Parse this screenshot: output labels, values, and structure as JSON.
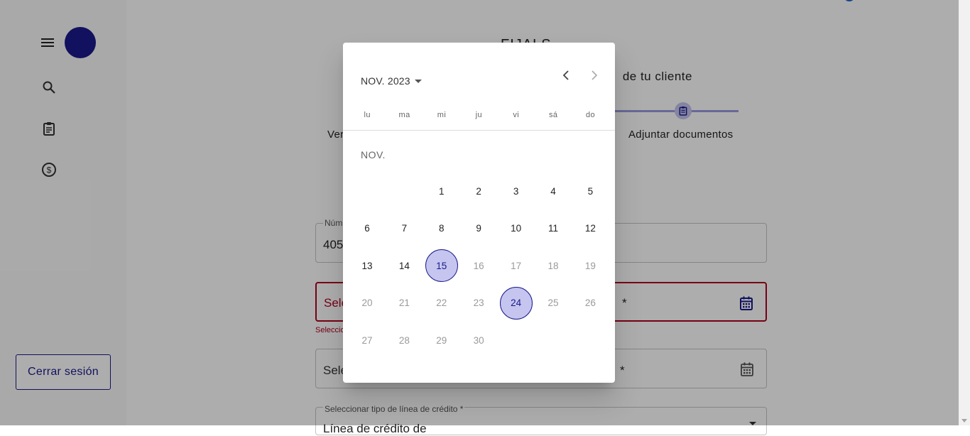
{
  "sidebar": {
    "logout_label": "Cerrar sesión",
    "icons": [
      "menu-icon",
      "search-icon",
      "clipboard-icon",
      "dollar-icon"
    ]
  },
  "header": {
    "title": "FIJALS",
    "step_title": "de tu cliente",
    "step_left_label": "Ver",
    "step_right_label": "Adjuntar documentos"
  },
  "form": {
    "field1_label": "Núm",
    "field1_value": "405",
    "field2_placeholder": "Sele",
    "field2_suffix": "*",
    "field2_helper": "Seleccio",
    "field3_placeholder": "Sele",
    "field3_suffix": "*",
    "field4_label": "Seleccionar tipo de línea de crédito *",
    "field4_value": "Línea de crédito de"
  },
  "datepicker": {
    "period_label": "NOV. 2023",
    "month_label": "NOV.",
    "weekdays": [
      "lu",
      "ma",
      "mi",
      "ju",
      "vi",
      "sá",
      "do"
    ],
    "days": [
      {
        "d": "1",
        "state": "enabled"
      },
      {
        "d": "2",
        "state": "enabled"
      },
      {
        "d": "3",
        "state": "enabled"
      },
      {
        "d": "4",
        "state": "enabled"
      },
      {
        "d": "5",
        "state": "enabled"
      },
      {
        "d": "6",
        "state": "enabled"
      },
      {
        "d": "7",
        "state": "enabled"
      },
      {
        "d": "8",
        "state": "enabled"
      },
      {
        "d": "9",
        "state": "enabled"
      },
      {
        "d": "10",
        "state": "enabled"
      },
      {
        "d": "11",
        "state": "enabled"
      },
      {
        "d": "12",
        "state": "enabled"
      },
      {
        "d": "13",
        "state": "enabled"
      },
      {
        "d": "14",
        "state": "enabled"
      },
      {
        "d": "15",
        "state": "selected"
      },
      {
        "d": "16",
        "state": "disabled"
      },
      {
        "d": "17",
        "state": "disabled"
      },
      {
        "d": "18",
        "state": "disabled"
      },
      {
        "d": "19",
        "state": "disabled"
      },
      {
        "d": "20",
        "state": "disabled"
      },
      {
        "d": "21",
        "state": "disabled"
      },
      {
        "d": "22",
        "state": "disabled"
      },
      {
        "d": "23",
        "state": "disabled"
      },
      {
        "d": "24",
        "state": "selected"
      },
      {
        "d": "25",
        "state": "disabled"
      },
      {
        "d": "26",
        "state": "disabled"
      },
      {
        "d": "27",
        "state": "disabled"
      },
      {
        "d": "28",
        "state": "disabled"
      },
      {
        "d": "29",
        "state": "disabled"
      },
      {
        "d": "30",
        "state": "disabled"
      }
    ]
  },
  "colors": {
    "accent": "#1a1a8c",
    "selected_fill": "#c5c5ef",
    "error": "#b00020"
  }
}
